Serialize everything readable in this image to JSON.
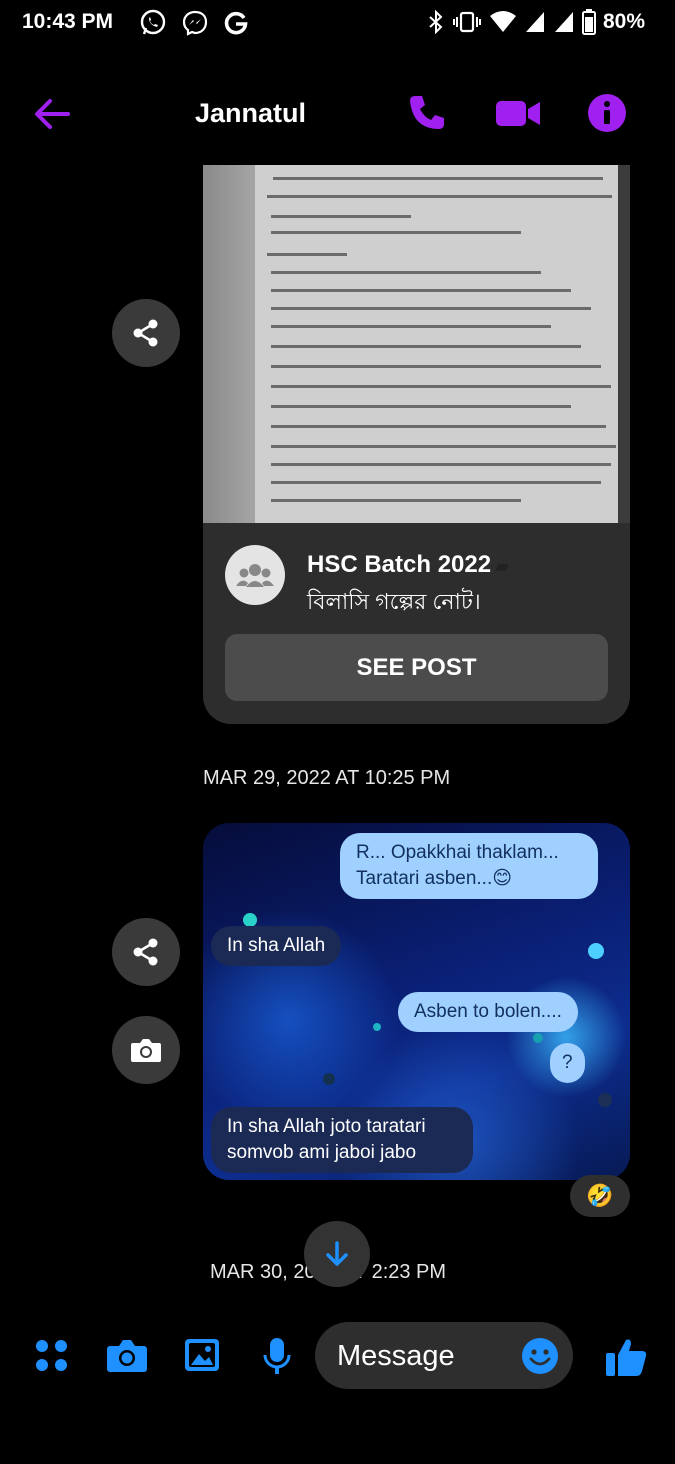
{
  "status_bar": {
    "time": "10:43 PM",
    "battery": "80%",
    "icons": [
      "whatsapp-icon",
      "messenger-icon",
      "google-icon",
      "bluetooth-icon",
      "vibrate-icon",
      "wifi-icon",
      "signal-icon",
      "signal-icon",
      "battery-icon"
    ]
  },
  "header": {
    "contact_name": "Jannatul",
    "accent": "#a020f0"
  },
  "shared_post": {
    "group_name": "HSC Batch 2022",
    "post_text": "বিলাসি  গল্পের নোট।",
    "button_label": "SEE POST"
  },
  "timestamps": {
    "first": "MAR 29, 2022 AT 10:25 PM",
    "second": "MAR 30, 2022 AT 2:23 PM"
  },
  "chat_image": {
    "bubbles": [
      {
        "text": "R... Opakkhai thaklam... Taratari asben...😊",
        "side": "sent"
      },
      {
        "text": "In sha Allah",
        "side": "received"
      },
      {
        "text": "Asben to bolen....",
        "side": "sent"
      },
      {
        "text": "?",
        "side": "sent"
      },
      {
        "text": "In sha Allah joto taratari somvob ami jaboi jabo",
        "side": "received"
      }
    ]
  },
  "reaction": "🤣",
  "composer": {
    "placeholder": "Message",
    "accent": "#1e90ff"
  }
}
